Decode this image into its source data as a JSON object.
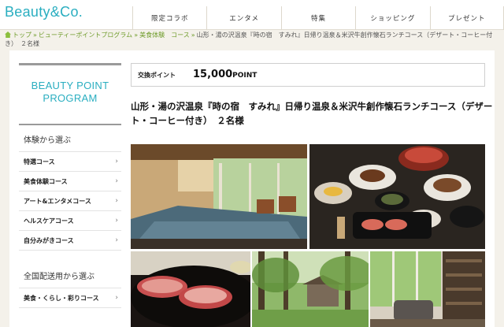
{
  "header": {
    "logo": "Beauty&Co.",
    "nav": [
      "限定コラボ",
      "エンタメ",
      "特集",
      "ショッピング",
      "プレゼント"
    ]
  },
  "breadcrumb": {
    "items": [
      "トップ",
      "ビューティーポイントプログラム",
      "美食体験　コース",
      "山形・湯の沢温泉『時の宿　すみれ』日帰り温泉＆米沢牛創作懐石ランチコース（デザート・コーヒー付き）　２名様"
    ],
    "separator": "»"
  },
  "sidebar": {
    "title_line1": "BEAUTY POINT",
    "title_line2": "PROGRAM",
    "section1": "体験から選ぶ",
    "items1": [
      "特選コース",
      "美食体験コース",
      "アート&エンタメコース",
      "ヘルスケアコース",
      "自分みがきコース"
    ],
    "section2": "全国配送用から選ぶ",
    "items2": [
      "美食・くらし・彩りコース"
    ],
    "chevron": "›"
  },
  "main": {
    "points_label": "交換ポイント",
    "points_value": "15,000",
    "points_unit": "POINT",
    "title": "山形・湯の沢温泉『時の宿　すみれ』日帰り温泉＆米沢牛創作懐石ランチコース（デザート・コーヒー付き）　２名様"
  },
  "colors": {
    "accent": "#2aaec0",
    "breadcrumb_link": "#6f9c2b",
    "page_bg": "#f4f1ea"
  }
}
